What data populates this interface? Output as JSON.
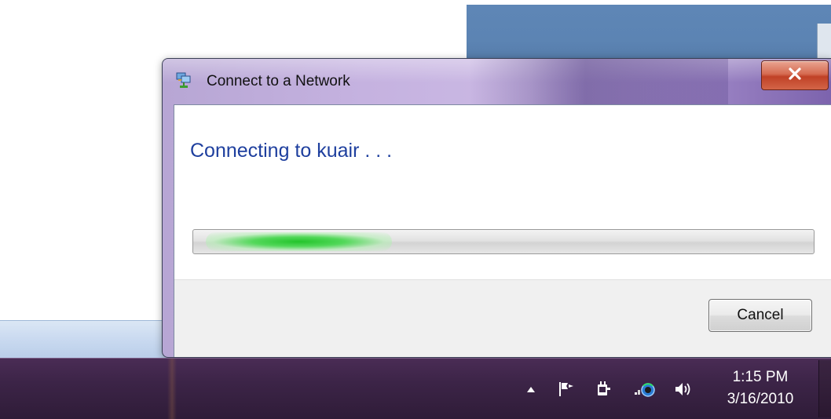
{
  "dialog": {
    "title": "Connect to a Network",
    "close_label": "x",
    "heading": "Connecting to kuair . . .",
    "progress": {
      "state": "indeterminate",
      "glow_start_percent": 2,
      "glow_width_percent": 30
    },
    "cancel_label": "Cancel"
  },
  "taskbar": {
    "tray_icons": [
      "show-hidden-icons-arrow",
      "action-center-flag-icon",
      "power-plug-icon",
      "network-connecting-icon",
      "volume-icon"
    ],
    "clock": {
      "time": "1:15 PM",
      "date": "3/16/2010"
    }
  },
  "colors": {
    "heading": "#1e3f9e",
    "progress_glow": "#23c42b",
    "close_button": "#c04126",
    "taskbar": "#3c2447",
    "desktop_window": "#5c84b3"
  }
}
